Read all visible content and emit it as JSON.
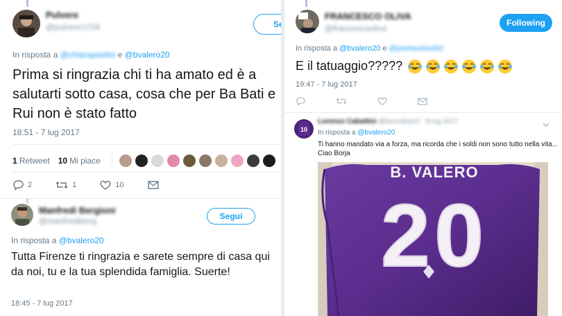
{
  "left": {
    "tweet1": {
      "display_name": "Pulvere",
      "handle": "@pulvere1234",
      "follow_label": "Se",
      "reply_prefix": "In risposta a",
      "reply_blurred": "@chiarapaolini",
      "reply_and": "e",
      "reply_handle": "@bvalero20",
      "text": "Prima si ringrazia chi ti ha amato ed è a salutarti sotto casa, cosa che per Ba Bati e Rui non è stato fatto",
      "timestamp": "18:51 - 7 lug 2017",
      "retweet_count": "1",
      "retweet_label": "Retweet",
      "like_count": "10",
      "like_label": "Mi piace",
      "reply_count": "2",
      "rt_action_count": "1",
      "like_action_count": "10"
    },
    "tweet2": {
      "display_name": "Manfredi Bergioni",
      "handle": "@manfrediberg",
      "follow_label": "Segui",
      "reply_prefix": "In risposta a",
      "reply_handle": "@bvalero20",
      "text": "Tutta Firenze ti ringrazia e sarete sempre di casa qui da noi, tu e la tua splendida famiglia. Suerte!",
      "timestamp": "18:45 - 7 lug 2017"
    }
  },
  "right": {
    "tweet1": {
      "display_name": "FRANCESCO OLIVA",
      "handle": "@francescooliva",
      "follow_label": "Following",
      "reply_prefix": "In risposta a",
      "reply_handle": "@bvalero20",
      "reply_and": "e",
      "reply_blurred": "@paolacelosi92",
      "text": "E il tatuaggio?????",
      "timestamp": "19:47 - 7 lug 2017"
    },
    "tweet2": {
      "display_name": "Lorenzo Cabattini",
      "handle": "@lorecaba10",
      "meta_blurred": "· 8 lug 2017",
      "reply_prefix": "In risposta a",
      "reply_handle": "@bvalero20",
      "text_line1": "Ti hanno mandato via a forza, ma ricorda che i soldi non sono tutto nella vita...",
      "text_line2": "Ciao Borja",
      "shirt_name": "B. VALERO",
      "shirt_number": "20",
      "avatar_number": "10"
    }
  },
  "colors": {
    "accent": "#1da1f2",
    "muted": "#657786",
    "text": "#14171a",
    "border": "#e6ecf0",
    "jersey": "#5b2d8e"
  }
}
